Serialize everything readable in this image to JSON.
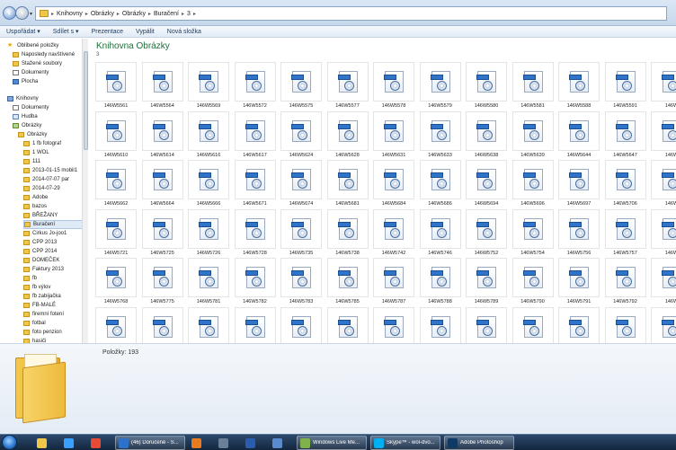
{
  "address": {
    "crumbs": [
      "Knihovny",
      "Obrázky",
      "Obrázky",
      "Buračení",
      "3"
    ]
  },
  "toolbar": {
    "organize": "Uspořádat ▾",
    "share": "Sdílet s ▾",
    "slideshow": "Prezentace",
    "burn": "Vypálit",
    "new_folder": "Nová složka"
  },
  "nav": {
    "favorites_header": "Oblíbené položky",
    "favorites": [
      "Naposledy navštívené",
      "Stažené soubory",
      "Dokumenty",
      "Plocha"
    ],
    "libraries_header": "Knihovny",
    "libraries": [
      "Dokumenty",
      "Hudba",
      "Obrázky"
    ],
    "pictures_sub": "Obrázky",
    "folders": [
      "1 fb fotograf",
      "1 WOL",
      "111",
      "2013-01-15 mobil1",
      "2014-07-07 par",
      "2014-07-29",
      "Adobe",
      "bazos",
      "BŘEŽANY",
      "Buračení",
      "Cirkus Jo-joo1",
      "CPP 2013",
      "CPP 2014",
      "DOMEČEK",
      "Faktury 2013",
      "fb",
      "fb výlov",
      "fb zabijačka",
      "FB-MALÉ",
      "firemní fotení",
      "fotbal",
      "foto penzion",
      "hasiči",
      "JEEPY"
    ]
  },
  "content": {
    "title": "Knihovna Obrázky",
    "subtitle": "3",
    "file_badge": "CR2",
    "rows": [
      [
        "146W5561",
        "146W5564",
        "146W5569",
        "146W5572",
        "146W5575",
        "146W5577",
        "146W5578",
        "146W5579",
        "146W5580",
        "146W5581",
        "146W5588",
        "146W5591",
        "146W"
      ],
      [
        "146W5610",
        "146W5614",
        "146W5616",
        "146W5617",
        "146W5624",
        "146W5628",
        "146W5631",
        "146W5633",
        "146W5638",
        "146W5639",
        "146W5644",
        "146W5647",
        "146W"
      ],
      [
        "146W5662",
        "146W5664",
        "146W5666",
        "146W5671",
        "146W5674",
        "146W5681",
        "146W5684",
        "146W5686",
        "146W5694",
        "146W5696",
        "146W5697",
        "146W5706",
        "146W"
      ],
      [
        "146W5721",
        "146W5725",
        "146W5726",
        "146W5728",
        "146W5735",
        "146W5738",
        "146W5742",
        "146W5746",
        "146W5752",
        "146W5754",
        "146W5756",
        "146W5757",
        "146W"
      ],
      [
        "146W5768",
        "146W5775",
        "146W5781",
        "146W5782",
        "146W5783",
        "146W5785",
        "146W5787",
        "146W5788",
        "146W5789",
        "146W5790",
        "146W5791",
        "146W5792",
        "146W"
      ],
      [
        "",
        "",
        "",
        "",
        "",
        "",
        "",
        "",
        "",
        "",
        "",
        "",
        ""
      ]
    ]
  },
  "details": {
    "count": "Položky: 193"
  },
  "taskbar": {
    "items": [
      {
        "label": "",
        "color": "#f0c64a"
      },
      {
        "label": "",
        "color": "#3aa0ff"
      },
      {
        "label": "",
        "color": "#e84b35"
      },
      {
        "label": "(46) Doručené - S...",
        "color": "#2d72c8"
      },
      {
        "label": "",
        "color": "#e87a1f"
      },
      {
        "label": "",
        "color": "#6a7f98"
      },
      {
        "label": "",
        "color": "#2a5db0"
      },
      {
        "label": "",
        "color": "#5a8ad0"
      },
      {
        "label": "Windows Live Me...",
        "color": "#7fb24a"
      },
      {
        "label": "Skype™ - wol-dvo...",
        "color": "#00aff0"
      },
      {
        "label": "Adobe Photoshop",
        "color": "#0f3a66"
      }
    ]
  }
}
